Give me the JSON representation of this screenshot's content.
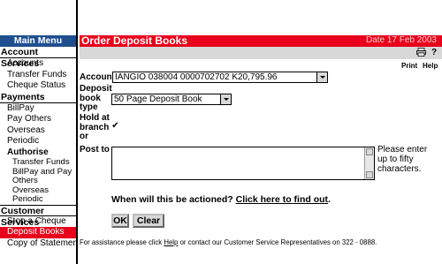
{
  "sidebar": {
    "header": "Main Menu",
    "account_services": {
      "title": "Account Services",
      "items": [
        "Accounts",
        "Transfer Funds",
        "Cheque Status"
      ]
    },
    "payments": {
      "title": "Payments",
      "items": [
        "BillPay",
        "Pay Others",
        "Overseas",
        "Periodic"
      ],
      "authorise": {
        "title": "Authorise",
        "items": [
          "Transfer Funds",
          "BillPay and Pay Others",
          "Overseas",
          "Periodic"
        ]
      }
    },
    "customer_services": {
      "title": "Customer Services",
      "items": [
        "Stop a Cheque",
        "Deposit Books",
        "Copy of Statement"
      ],
      "active": "Deposit Books"
    }
  },
  "header": {
    "title": "Order Deposit Books",
    "date": "Date 17 Feb 2003",
    "print_label": "Print",
    "help_label": "Help",
    "print_icon": "printer-icon",
    "help_icon": "question-icon"
  },
  "form": {
    "account_label": "Account",
    "account_value": "IANGIO  038004  0000702702  K20,795.96",
    "deposit_book_type_label": "Deposit book type",
    "deposit_book_type_value": "50 Page Deposit Book",
    "hold_label": "Hold at branch or",
    "hold_checked": "✔",
    "post_to_label": "Post to",
    "post_to_value": "",
    "hint": "Please enter up to fifty characters.",
    "when_text": "When will this be actioned?",
    "when_link": "Click here to find out",
    "when_suffix": ".",
    "ok_button": "OK",
    "clear_button": "Clear"
  },
  "footer": {
    "prefix": "For assistance please click",
    "help_link": "Help",
    "suffix": "or contact our Customer Service Representatives on 322 - 0888."
  },
  "colors": {
    "sidebar_header": "#1f4f8f",
    "title_bar": "#e8001c",
    "active_item": "#e8001c",
    "toolbar": "#d8d8d8"
  }
}
